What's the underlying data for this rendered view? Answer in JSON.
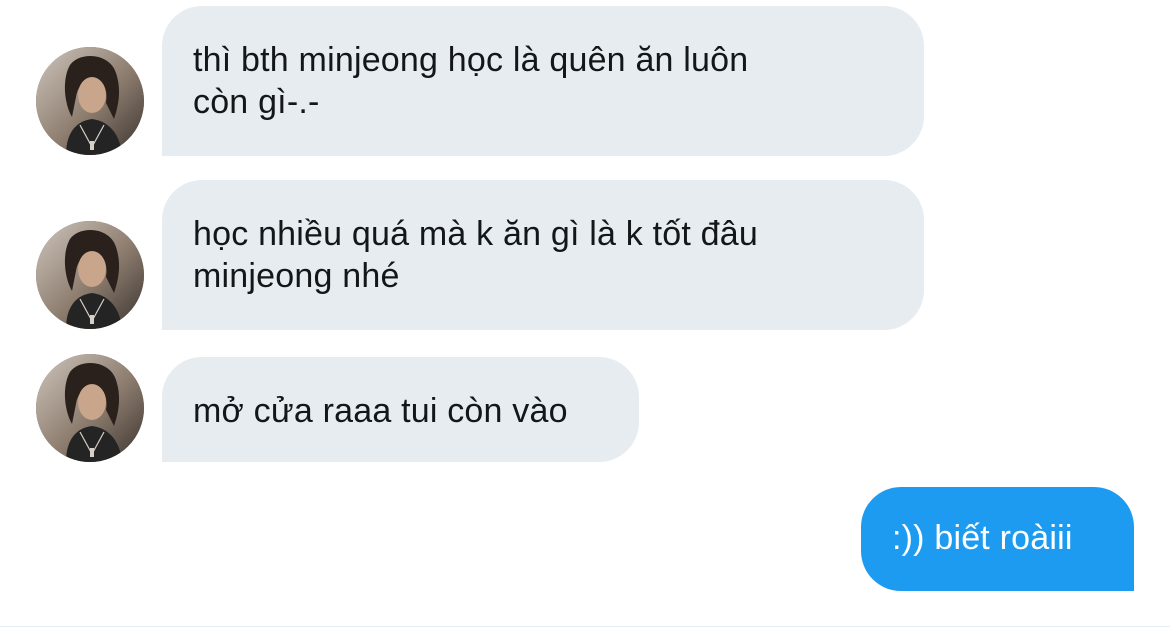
{
  "messages": [
    {
      "direction": "incoming",
      "lines": [
        "thì bth minjeong học là quên ăn luôn",
        "còn gì-.-"
      ]
    },
    {
      "direction": "incoming",
      "lines": [
        "học nhiều quá mà k ăn gì là k tốt đâu",
        "minjeong nhé"
      ]
    },
    {
      "direction": "incoming",
      "lines": [
        "mở cửa raaa tui còn vào"
      ]
    },
    {
      "direction": "outgoing",
      "lines": [
        ":)) biết roàiii"
      ]
    }
  ],
  "colors": {
    "incoming_bubble": "#e6ecf0",
    "outgoing_bubble": "#1d9bf0",
    "incoming_text": "#14171a",
    "outgoing_text": "#ffffff"
  },
  "avatar_icon": "profile-photo-avatar"
}
